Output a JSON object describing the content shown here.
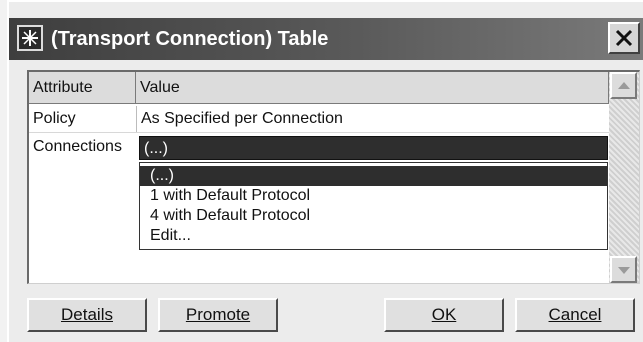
{
  "window": {
    "title": "(Transport Connection) Table"
  },
  "table": {
    "columns": [
      "Attribute",
      "Value"
    ],
    "rows": [
      {
        "attribute": "Policy",
        "value": "As Specified per Connection"
      },
      {
        "attribute": "Connections",
        "value": "(...)"
      }
    ]
  },
  "dropdown": {
    "selected": "(...)",
    "options": [
      "(...)",
      "1 with Default Protocol",
      "4 with Default Protocol",
      "Edit..."
    ]
  },
  "buttons": {
    "details": "Details",
    "promote": "Promote",
    "ok": "OK",
    "cancel": "Cancel"
  },
  "icons": {
    "app": "star-icon",
    "close": "close-icon",
    "scroll_up": "arrow-up-icon",
    "scroll_down": "arrow-down-icon"
  }
}
